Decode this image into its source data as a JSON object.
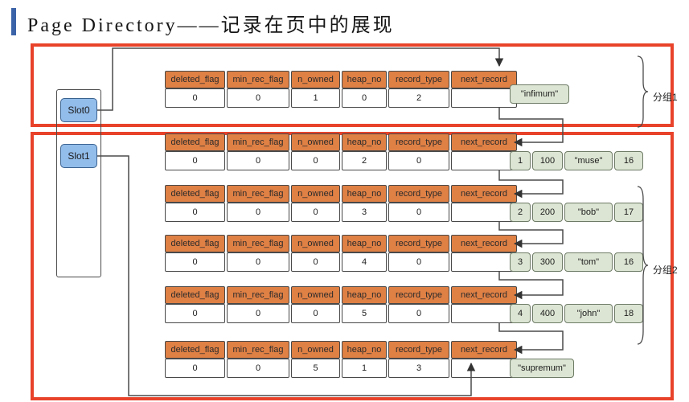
{
  "title": "Page Directory——记录在页中的展现",
  "columns": [
    "deleted_flag",
    "min_rec_flag",
    "n_owned",
    "heap_no",
    "record_type",
    "next_record"
  ],
  "slots": [
    {
      "label": "Slot0"
    },
    {
      "label": "Slot1"
    }
  ],
  "groups": [
    {
      "label": "分组1"
    },
    {
      "label": "分组2"
    }
  ],
  "records": [
    {
      "deleted_flag": "0",
      "min_rec_flag": "0",
      "n_owned": "1",
      "heap_no": "0",
      "record_type": "2",
      "next_record": "",
      "payload_kind": "label",
      "payload_label": "\"infimum\""
    },
    {
      "deleted_flag": "0",
      "min_rec_flag": "0",
      "n_owned": "0",
      "heap_no": "2",
      "record_type": "0",
      "next_record": "",
      "payload_kind": "row",
      "id": "1",
      "num": "100",
      "name": "\"muse\"",
      "extra": "16"
    },
    {
      "deleted_flag": "0",
      "min_rec_flag": "0",
      "n_owned": "0",
      "heap_no": "3",
      "record_type": "0",
      "next_record": "",
      "payload_kind": "row",
      "id": "2",
      "num": "200",
      "name": "\"bob\"",
      "extra": "17"
    },
    {
      "deleted_flag": "0",
      "min_rec_flag": "0",
      "n_owned": "0",
      "heap_no": "4",
      "record_type": "0",
      "next_record": "",
      "payload_kind": "row",
      "id": "3",
      "num": "300",
      "name": "\"tom\"",
      "extra": "16"
    },
    {
      "deleted_flag": "0",
      "min_rec_flag": "0",
      "n_owned": "0",
      "heap_no": "5",
      "record_type": "0",
      "next_record": "",
      "payload_kind": "row",
      "id": "4",
      "num": "400",
      "name": "\"john\"",
      "extra": "18"
    },
    {
      "deleted_flag": "0",
      "min_rec_flag": "0",
      "n_owned": "5",
      "heap_no": "1",
      "record_type": "3",
      "next_record": "",
      "payload_kind": "label",
      "payload_label": "\"supremum\""
    }
  ],
  "colors": {
    "header_orange": "#DF8045",
    "group_red": "#E8432A",
    "slot_blue": "#92BCEA",
    "payload_green": "#DCE5D3",
    "title_bar_blue": "#3B63A8"
  }
}
